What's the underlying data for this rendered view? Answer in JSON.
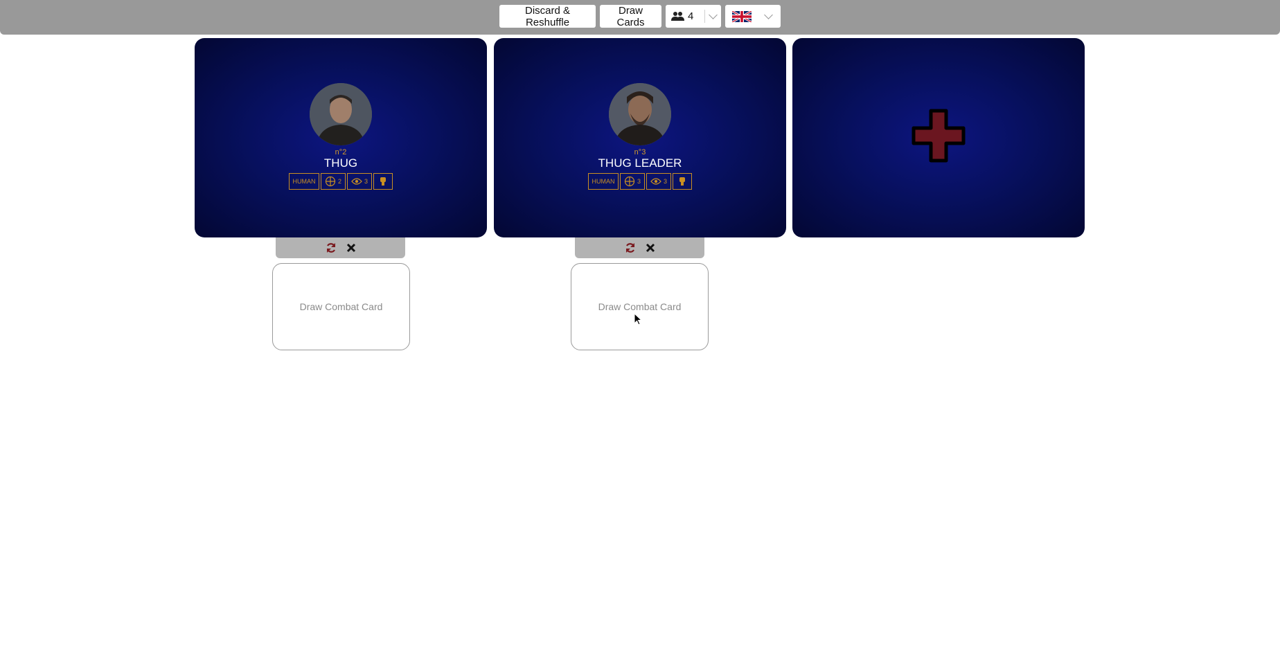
{
  "toolbar": {
    "discard_label": "Discard & Reshuffle",
    "draw_label": "Draw Cards",
    "players_value": "4",
    "players_icon": "users-icon",
    "language_icon": "uk-flag-icon"
  },
  "enemies": [
    {
      "number": "n°2",
      "name": "THUG",
      "type": "HUMAN",
      "move": "2",
      "perception": "3",
      "draw_card_label": "Draw Combat Card"
    },
    {
      "number": "n°3",
      "name": "THUG LEADER",
      "type": "HUMAN",
      "move": "3",
      "perception": "3",
      "draw_card_label": "Draw Combat Card"
    }
  ],
  "add_card": {
    "icon": "plus-icon"
  },
  "colors": {
    "topbar": "#999999",
    "card_bg": "#07105e",
    "accent_gold": "#c98f22",
    "plus": "#6b1620"
  }
}
